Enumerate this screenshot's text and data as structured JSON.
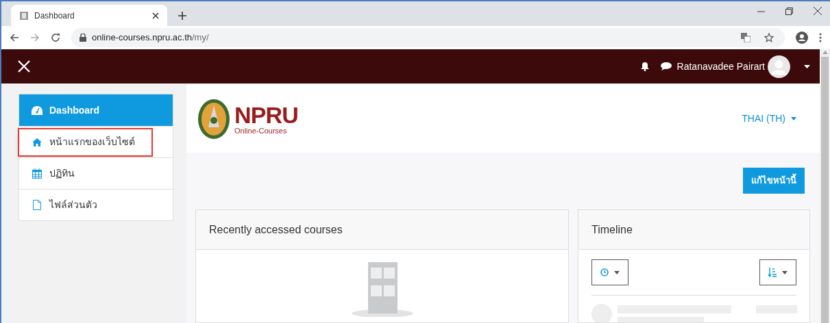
{
  "browser": {
    "tab_title": "Dashboard",
    "url_host": "online-courses.npru.ac.th",
    "url_path": "/my/"
  },
  "navbar": {
    "user_name": "Ratanavadee Pairart"
  },
  "sidebar": {
    "items": [
      {
        "label": "Dashboard",
        "kind": "dashboard",
        "selected": true,
        "highlighted": false
      },
      {
        "label": "หน้าแรกของเว็บไซต์",
        "kind": "home",
        "selected": false,
        "highlighted": true
      },
      {
        "label": "ปฏิทิน",
        "kind": "calendar",
        "selected": false,
        "highlighted": false
      },
      {
        "label": "ไฟล์ส่วนตัว",
        "kind": "file",
        "selected": false,
        "highlighted": false
      }
    ]
  },
  "header": {
    "logo_title": "NPRU",
    "logo_subtitle": "Online-Courses",
    "language": "THAI (TH)"
  },
  "edit_button": "แก้ไขหน้านี้",
  "cards": [
    {
      "kind": "courses",
      "title": "Recently accessed courses"
    },
    {
      "kind": "timeline",
      "title": "Timeline"
    }
  ]
}
